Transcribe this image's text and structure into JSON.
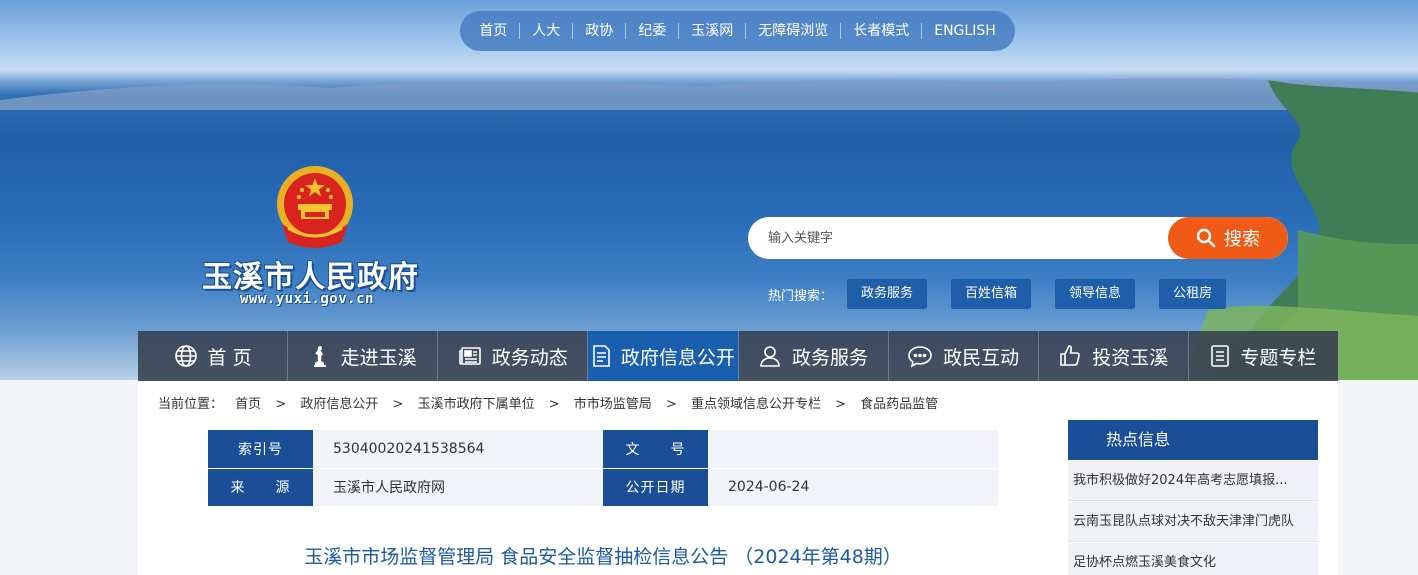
{
  "top_nav": [
    "首页",
    "人大",
    "政协",
    "纪委",
    "玉溪网",
    "无障碍浏览",
    "长者模式",
    "ENGLISH"
  ],
  "site": {
    "title": "玉溪市人民政府",
    "url": "www.yuxi.gov.cn"
  },
  "search": {
    "placeholder": "输入关键字",
    "button_label": "搜索"
  },
  "hot_search": {
    "label": "热门搜索：",
    "tags": [
      "政务服务",
      "百姓信箱",
      "领导信息",
      "公租房"
    ]
  },
  "main_nav": [
    {
      "label": "首 页",
      "icon": "globe-icon"
    },
    {
      "label": "走进玉溪",
      "icon": "statue-icon"
    },
    {
      "label": "政务动态",
      "icon": "newspaper-icon"
    },
    {
      "label": "政府信息公开",
      "icon": "document-icon",
      "active": true
    },
    {
      "label": "政务服务",
      "icon": "user-icon"
    },
    {
      "label": "政民互动",
      "icon": "chat-icon"
    },
    {
      "label": "投资玉溪",
      "icon": "thumbs-up-icon"
    },
    {
      "label": "专题专栏",
      "icon": "list-icon"
    }
  ],
  "breadcrumb": {
    "label": "当前位置：",
    "items": [
      "首页",
      "政府信息公开",
      "玉溪市政府下属单位",
      "市市场监管局",
      "重点领域信息公开专栏",
      "食品药品监管"
    ]
  },
  "meta": {
    "index_label": "索引号",
    "index_value": "53040020241538564",
    "doc_label": "文　　号",
    "doc_value": "",
    "source_label": "来　　源",
    "source_value": "玉溪市人民政府网",
    "date_label": "公开日期",
    "date_value": "2024-06-24"
  },
  "article": {
    "title": "玉溪市市场监督管理局 食品安全监督抽检信息公告 （2024年第48期）"
  },
  "hot_info": {
    "header": "热点信息",
    "items": [
      "我市积极做好2024年高考志愿填报...",
      "云南玉昆队点球对决不敌天津津门虎队",
      "足协杯点燃玉溪美食文化"
    ]
  },
  "colors": {
    "nav_active": "#1a5fae",
    "search_button": "#f05a17",
    "table_key": "#1a4f97",
    "title_text": "#1a5aa6"
  }
}
